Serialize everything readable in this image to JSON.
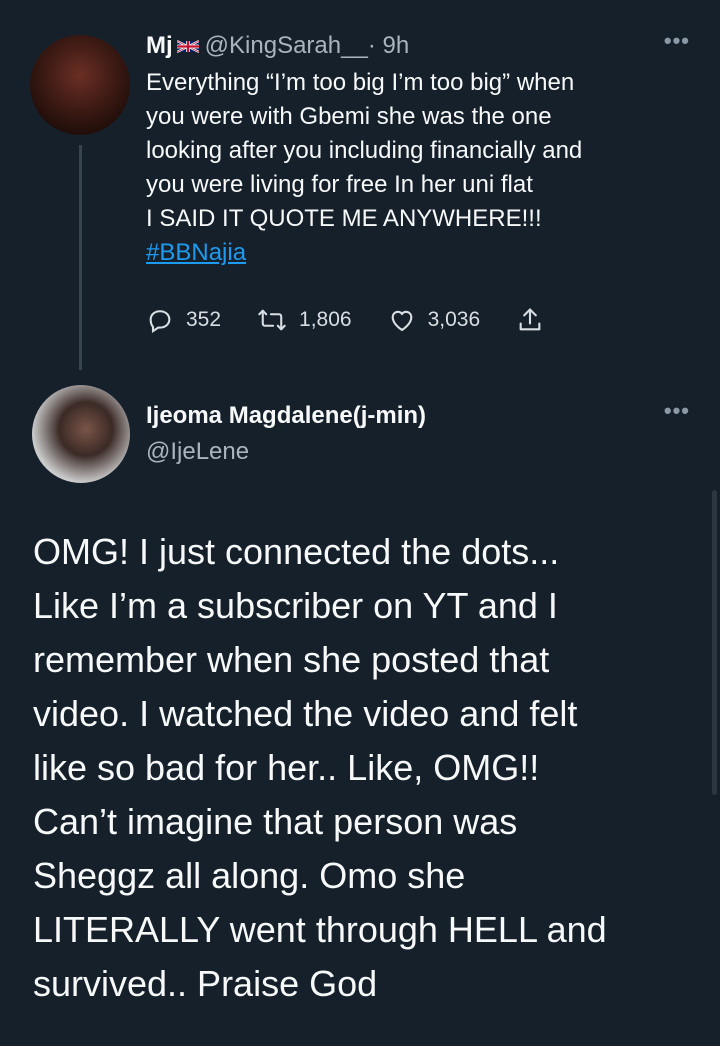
{
  "tweet1": {
    "name": "Mj",
    "handle": "@KingSarah__",
    "time": "· 9h",
    "flag_icon": "uk-flag-icon",
    "lines": [
      "Everything “I’m too big I’m too big” when",
      "you were with Gbemi she was the one",
      "looking after you including financially and",
      "you were living for free In her uni flat",
      "I SAID IT QUOTE ME ANYWHERE!!!"
    ],
    "hashtag": "#BBNajia",
    "replies": "352",
    "retweets": "1,806",
    "likes": "3,036",
    "more": "•••"
  },
  "tweet2": {
    "name": "Ijeoma Magdalene(j-min)",
    "handle": "@IjeLene",
    "more": "•••",
    "lines": [
      "OMG! I just connected the dots...",
      "Like I’m a subscriber on YT and I",
      "remember when she posted that",
      "video. I watched the video and felt",
      "like so bad for her.. Like, OMG!!",
      "Can’t imagine that person was",
      "Sheggz all along. Omo she",
      "LITERALLY went through HELL and",
      "survived.. Praise God"
    ]
  },
  "colors": {
    "background": "#15202b",
    "text": "#f7f9f9",
    "secondary": "#a9b4bd",
    "link": "#1d9bf0"
  }
}
